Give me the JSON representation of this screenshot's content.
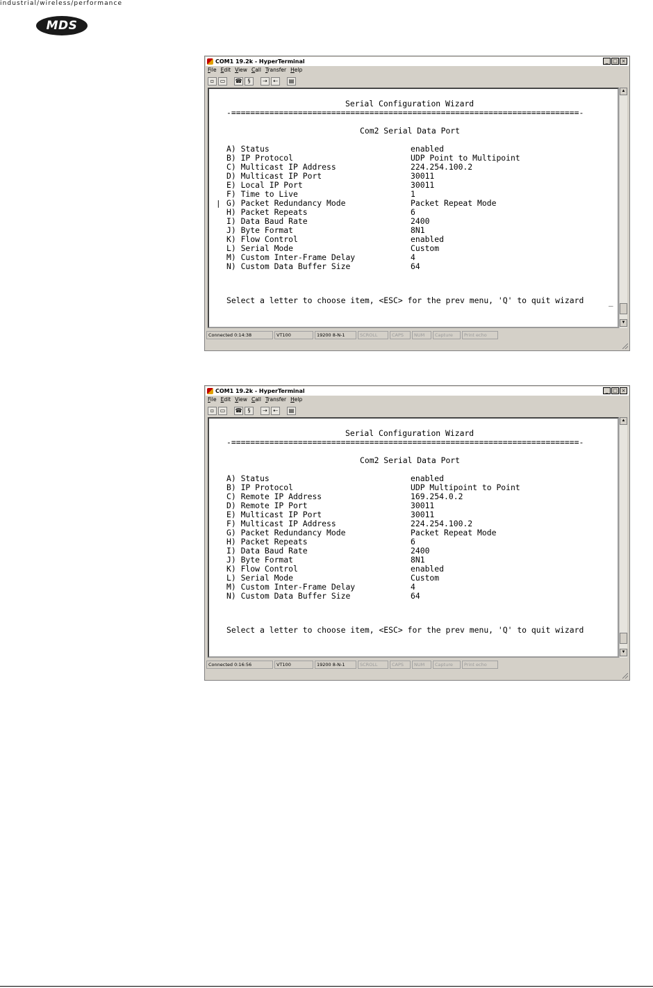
{
  "header": {
    "tagline": "industrial/wireless/performance",
    "logo_text": "MDS"
  },
  "windows": [
    {
      "title": "COM1 19.2k - HyperTerminal",
      "menu": [
        "File",
        "Edit",
        "View",
        "Call",
        "Transfer",
        "Help"
      ],
      "terminal": {
        "title": "Serial Configuration Wizard",
        "rule": "-=========================================================================-",
        "subtitle": "Com2 Serial Data Port",
        "items": [
          {
            "label": "A) Status",
            "value": "enabled"
          },
          {
            "label": "B) IP Protocol",
            "value": "UDP Point to Multipoint"
          },
          {
            "label": "C) Multicast IP Address",
            "value": "224.254.100.2"
          },
          {
            "label": "D) Multicast IP Port",
            "value": "30011"
          },
          {
            "label": "E) Local IP Port",
            "value": "30011"
          },
          {
            "label": "F) Time to Live",
            "value": "1"
          },
          {
            "label": "G) Packet Redundancy Mode",
            "value": "Packet Repeat Mode"
          },
          {
            "label": "H) Packet Repeats",
            "value": "6"
          },
          {
            "label": "I) Data Baud Rate",
            "value": "2400"
          },
          {
            "label": "J) Byte Format",
            "value": "8N1"
          },
          {
            "label": "K) Flow Control",
            "value": "enabled"
          },
          {
            "label": "L) Serial Mode",
            "value": "Custom"
          },
          {
            "label": "M) Custom Inter-Frame Delay",
            "value": "4"
          },
          {
            "label": "N) Custom Data Buffer Size",
            "value": "64"
          }
        ],
        "prompt": "Select a letter to choose item, <ESC> for the prev menu, 'Q' to quit wizard",
        "cursor": "_"
      },
      "status": [
        "Connected 0:14:38",
        "VT100",
        "19200 8-N-1",
        "SCROLL",
        "CAPS",
        "NUM",
        "Capture",
        "Print echo"
      ]
    },
    {
      "title": "COM1 19.2k - HyperTerminal",
      "menu": [
        "File",
        "Edit",
        "View",
        "Call",
        "Transfer",
        "Help"
      ],
      "terminal": {
        "title": "Serial Configuration Wizard",
        "rule": "-=========================================================================-",
        "subtitle": "Com2 Serial Data Port",
        "items": [
          {
            "label": "A) Status",
            "value": "enabled"
          },
          {
            "label": "B) IP Protocol",
            "value": "UDP Multipoint to Point"
          },
          {
            "label": "C) Remote IP Address",
            "value": "169.254.0.2"
          },
          {
            "label": "D) Remote IP Port",
            "value": "30011"
          },
          {
            "label": "E) Multicast IP Port",
            "value": "30011"
          },
          {
            "label": "F) Multicast IP Address",
            "value": "224.254.100.2"
          },
          {
            "label": "G) Packet Redundancy Mode",
            "value": "Packet Repeat Mode"
          },
          {
            "label": "H) Packet Repeats",
            "value": "6"
          },
          {
            "label": "I) Data Baud Rate",
            "value": "2400"
          },
          {
            "label": "J) Byte Format",
            "value": "8N1"
          },
          {
            "label": "K) Flow Control",
            "value": "enabled"
          },
          {
            "label": "L) Serial Mode",
            "value": "Custom"
          },
          {
            "label": "M) Custom Inter-Frame Delay",
            "value": "4"
          },
          {
            "label": "N) Custom Data Buffer Size",
            "value": "64"
          }
        ],
        "prompt": "Select a letter to choose item, <ESC> for the prev menu, 'Q' to quit wizard",
        "cursor": ""
      },
      "status": [
        "Connected 0:16:56",
        "VT100",
        "19200 8-N-1",
        "SCROLL",
        "CAPS",
        "NUM",
        "Capture",
        "Print echo"
      ]
    }
  ]
}
